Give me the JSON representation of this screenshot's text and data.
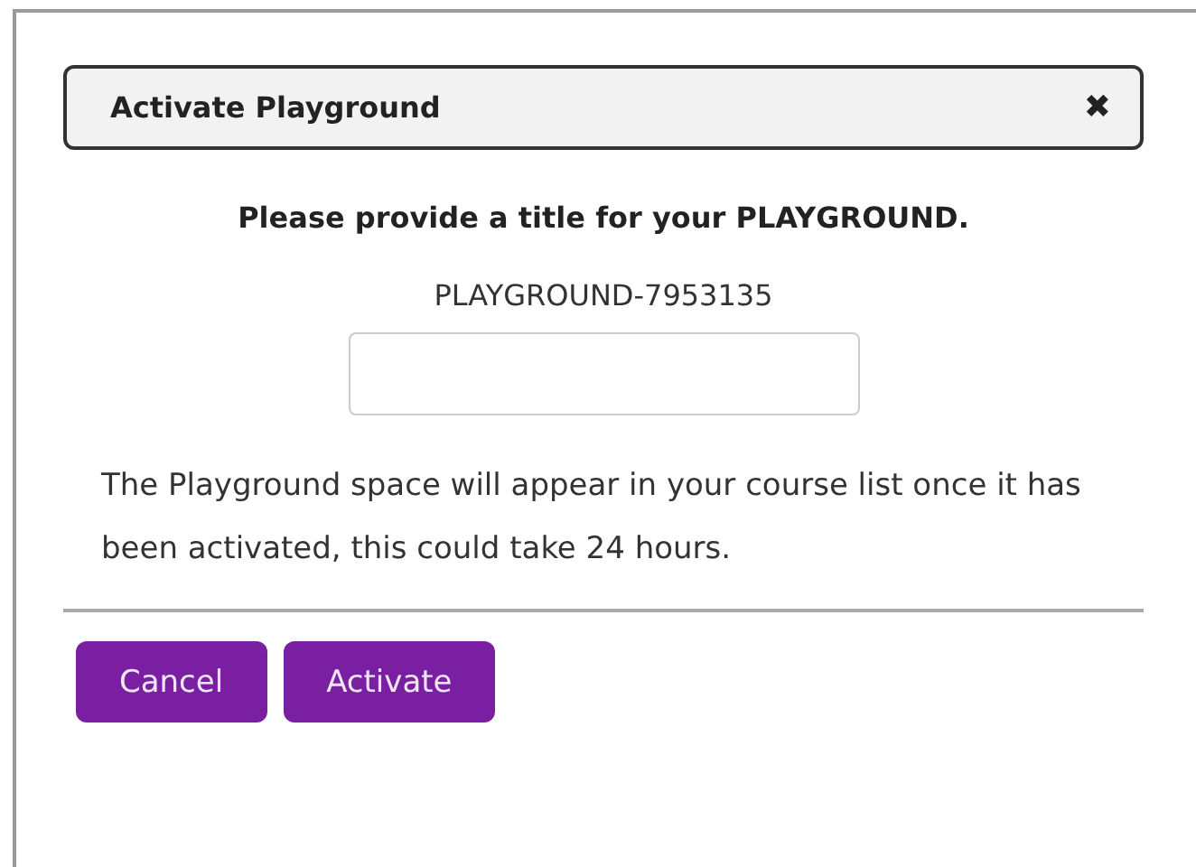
{
  "dialog": {
    "title": "Activate Playground",
    "close_glyph": "✖",
    "prompt": "Please provide a title for your PLAYGROUND.",
    "playground_id": "PLAYGROUND-7953135",
    "message": "The Playground space will appear in your course list once it has been activated, this could take 24 hours.",
    "buttons": [
      "Cancel",
      "Activate"
    ]
  }
}
